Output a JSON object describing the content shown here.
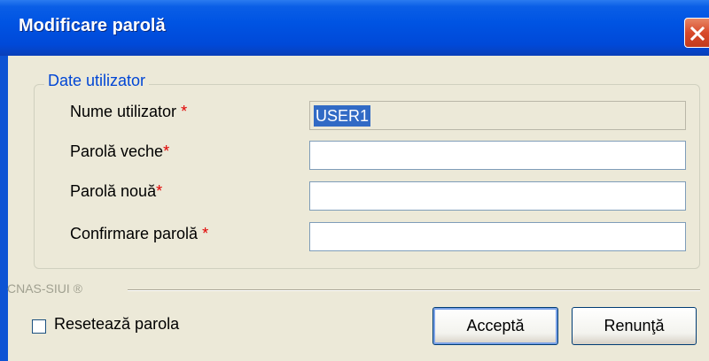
{
  "window": {
    "title": "Modificare parolă"
  },
  "group": {
    "legend": "Date utilizator"
  },
  "fields": {
    "username": {
      "label": "Nume utilizator",
      "required_mark": "*",
      "value": "USER1"
    },
    "old_password": {
      "label": "Parolă veche",
      "required_mark": "*",
      "value": ""
    },
    "new_password": {
      "label": "Parolă nouă",
      "required_mark": "*",
      "value": ""
    },
    "confirm_password": {
      "label": "Confirmare parolă",
      "required_mark": "*",
      "value": ""
    }
  },
  "footer": {
    "brand": "CNAS-SIUI ®",
    "reset_label": "Resetează parola",
    "reset_checked": false,
    "accept_label": "Acceptă",
    "cancel_label": "Renunţă"
  },
  "colors": {
    "titlebar": "#0054e3",
    "client_bg": "#ece9d8",
    "legend_text": "#0046d5",
    "required_mark": "#e00000",
    "selection": "#316ac5",
    "close_button": "#d8492a"
  },
  "icons": {
    "close": "close-icon"
  }
}
